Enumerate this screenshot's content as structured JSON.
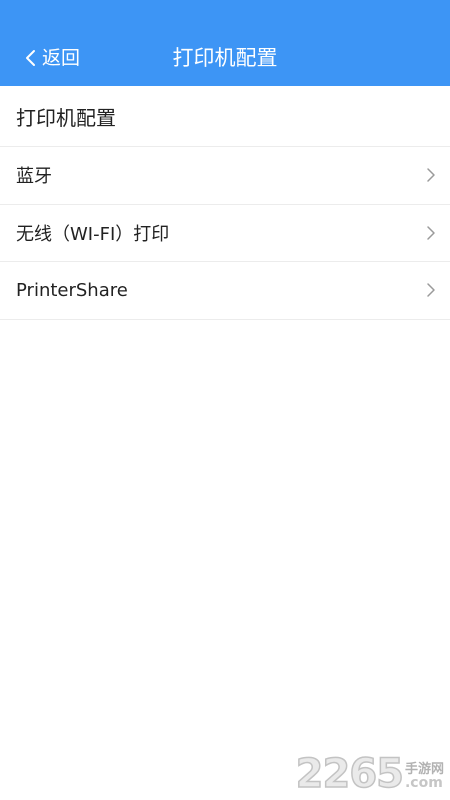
{
  "header": {
    "back_label": "返回",
    "title": "打印机配置",
    "background_color": "#3d95f5"
  },
  "section": {
    "heading": "打印机配置"
  },
  "items": [
    {
      "label": "蓝牙",
      "icon": "chevron-right-icon"
    },
    {
      "label": "无线（WI-FI）打印",
      "icon": "chevron-right-icon"
    },
    {
      "label": "PrinterShare",
      "icon": "chevron-right-icon"
    }
  ],
  "watermark": {
    "number": "2265",
    "site_cn": "手游网",
    "site_suffix": ".com"
  }
}
